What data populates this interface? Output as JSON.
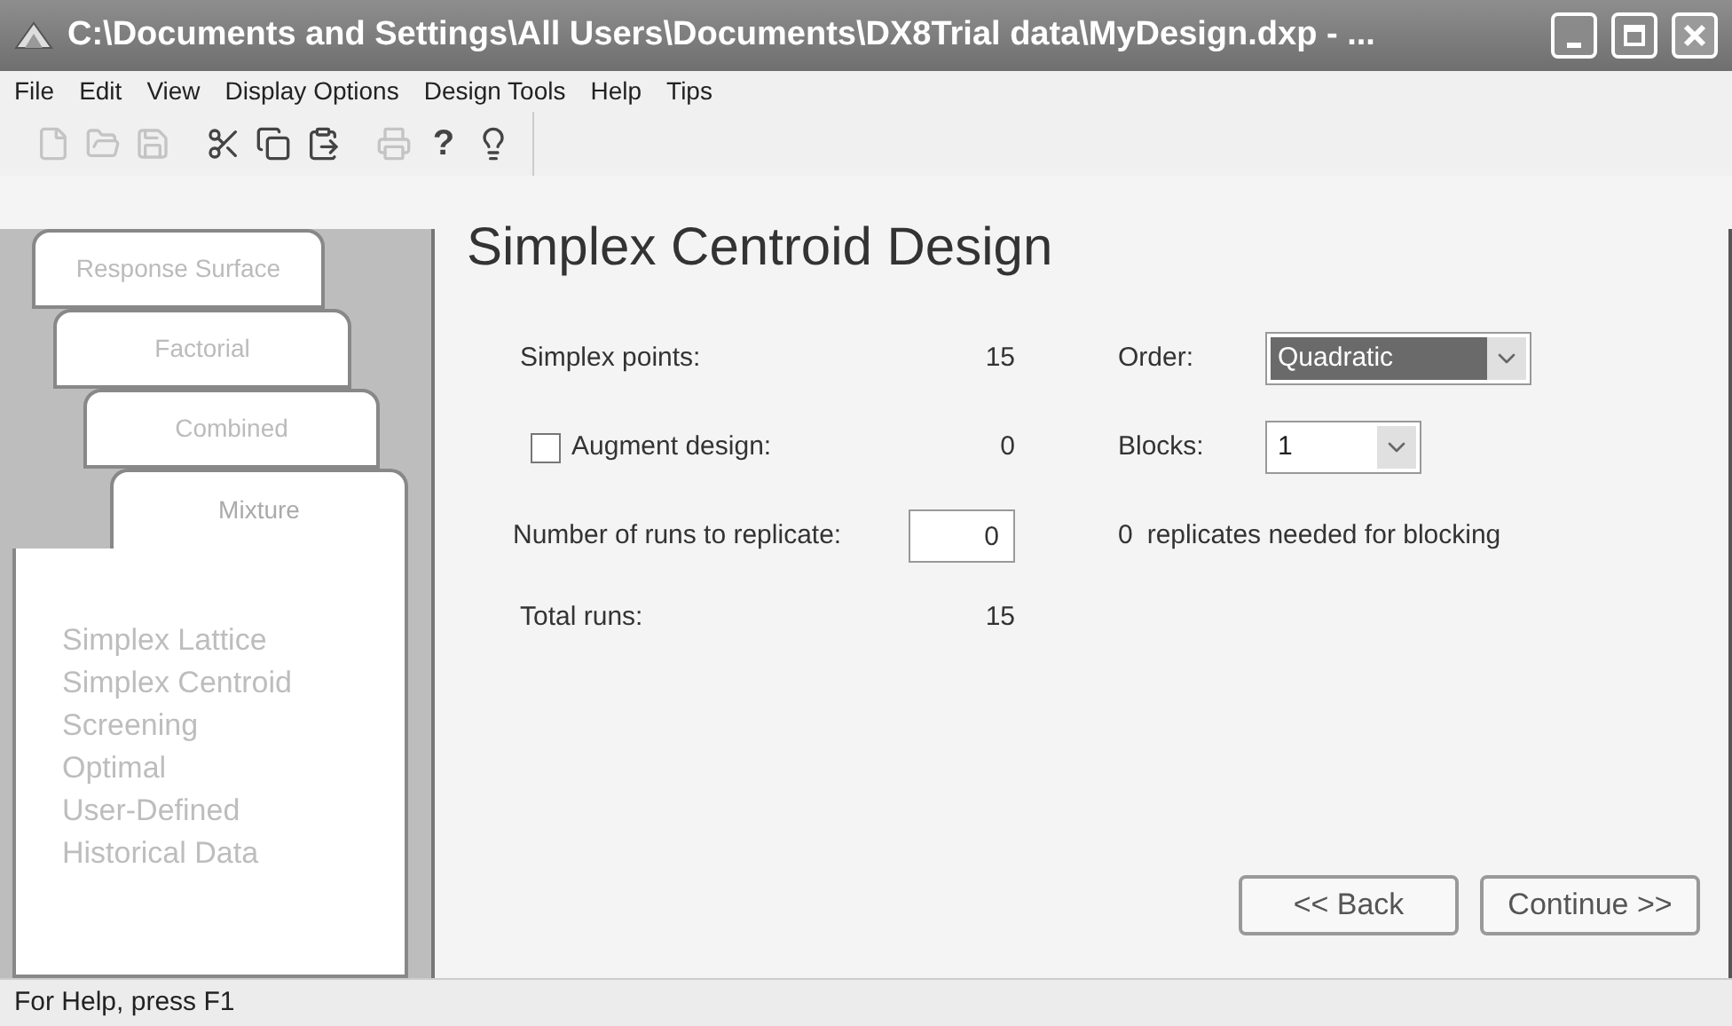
{
  "window": {
    "title": "C:\\Documents and Settings\\All Users\\Documents\\DX8Trial data\\MyDesign.dxp - ..."
  },
  "menu": [
    "File",
    "Edit",
    "View",
    "Display Options",
    "Design Tools",
    "Help",
    "Tips"
  ],
  "toolbar": [
    {
      "kind": "new",
      "disabled": true
    },
    {
      "kind": "open",
      "disabled": true
    },
    {
      "kind": "save",
      "disabled": true
    },
    {
      "kind": "sep"
    },
    {
      "kind": "cut",
      "disabled": false
    },
    {
      "kind": "copy",
      "disabled": false
    },
    {
      "kind": "paste",
      "disabled": false
    },
    {
      "kind": "sep"
    },
    {
      "kind": "print",
      "disabled": true
    },
    {
      "kind": "help",
      "label": "?",
      "disabled": false
    },
    {
      "kind": "tip",
      "disabled": false
    }
  ],
  "design_tabs": [
    {
      "label": "Response Surface",
      "selected": false
    },
    {
      "label": "Factorial",
      "selected": false
    },
    {
      "label": "Combined",
      "selected": false
    },
    {
      "label": "Mixture",
      "selected": true
    }
  ],
  "design_types": [
    "Simplex Lattice",
    "Simplex Centroid",
    "Screening",
    "Optimal",
    "User-Defined",
    "Historical Data"
  ],
  "heading": "Simplex Centroid Design",
  "form": {
    "simplex_points": {
      "label": "Simplex points:",
      "value": "15"
    },
    "augment": {
      "label": "Augment design:",
      "checked": false,
      "value": "0"
    },
    "replicate": {
      "label": "Number of runs to replicate:",
      "value": "0"
    },
    "total": {
      "label": "Total runs:",
      "value": "15"
    },
    "order": {
      "label": "Order:",
      "value": "Quadratic"
    },
    "blocks": {
      "label": "Blocks:",
      "value": "1"
    },
    "replicates_note": {
      "count": "0",
      "text": "replicates needed for blocking"
    }
  },
  "buttons": [
    "<< Back",
    "Continue >>"
  ],
  "status_bar": "For Help, press F1"
}
